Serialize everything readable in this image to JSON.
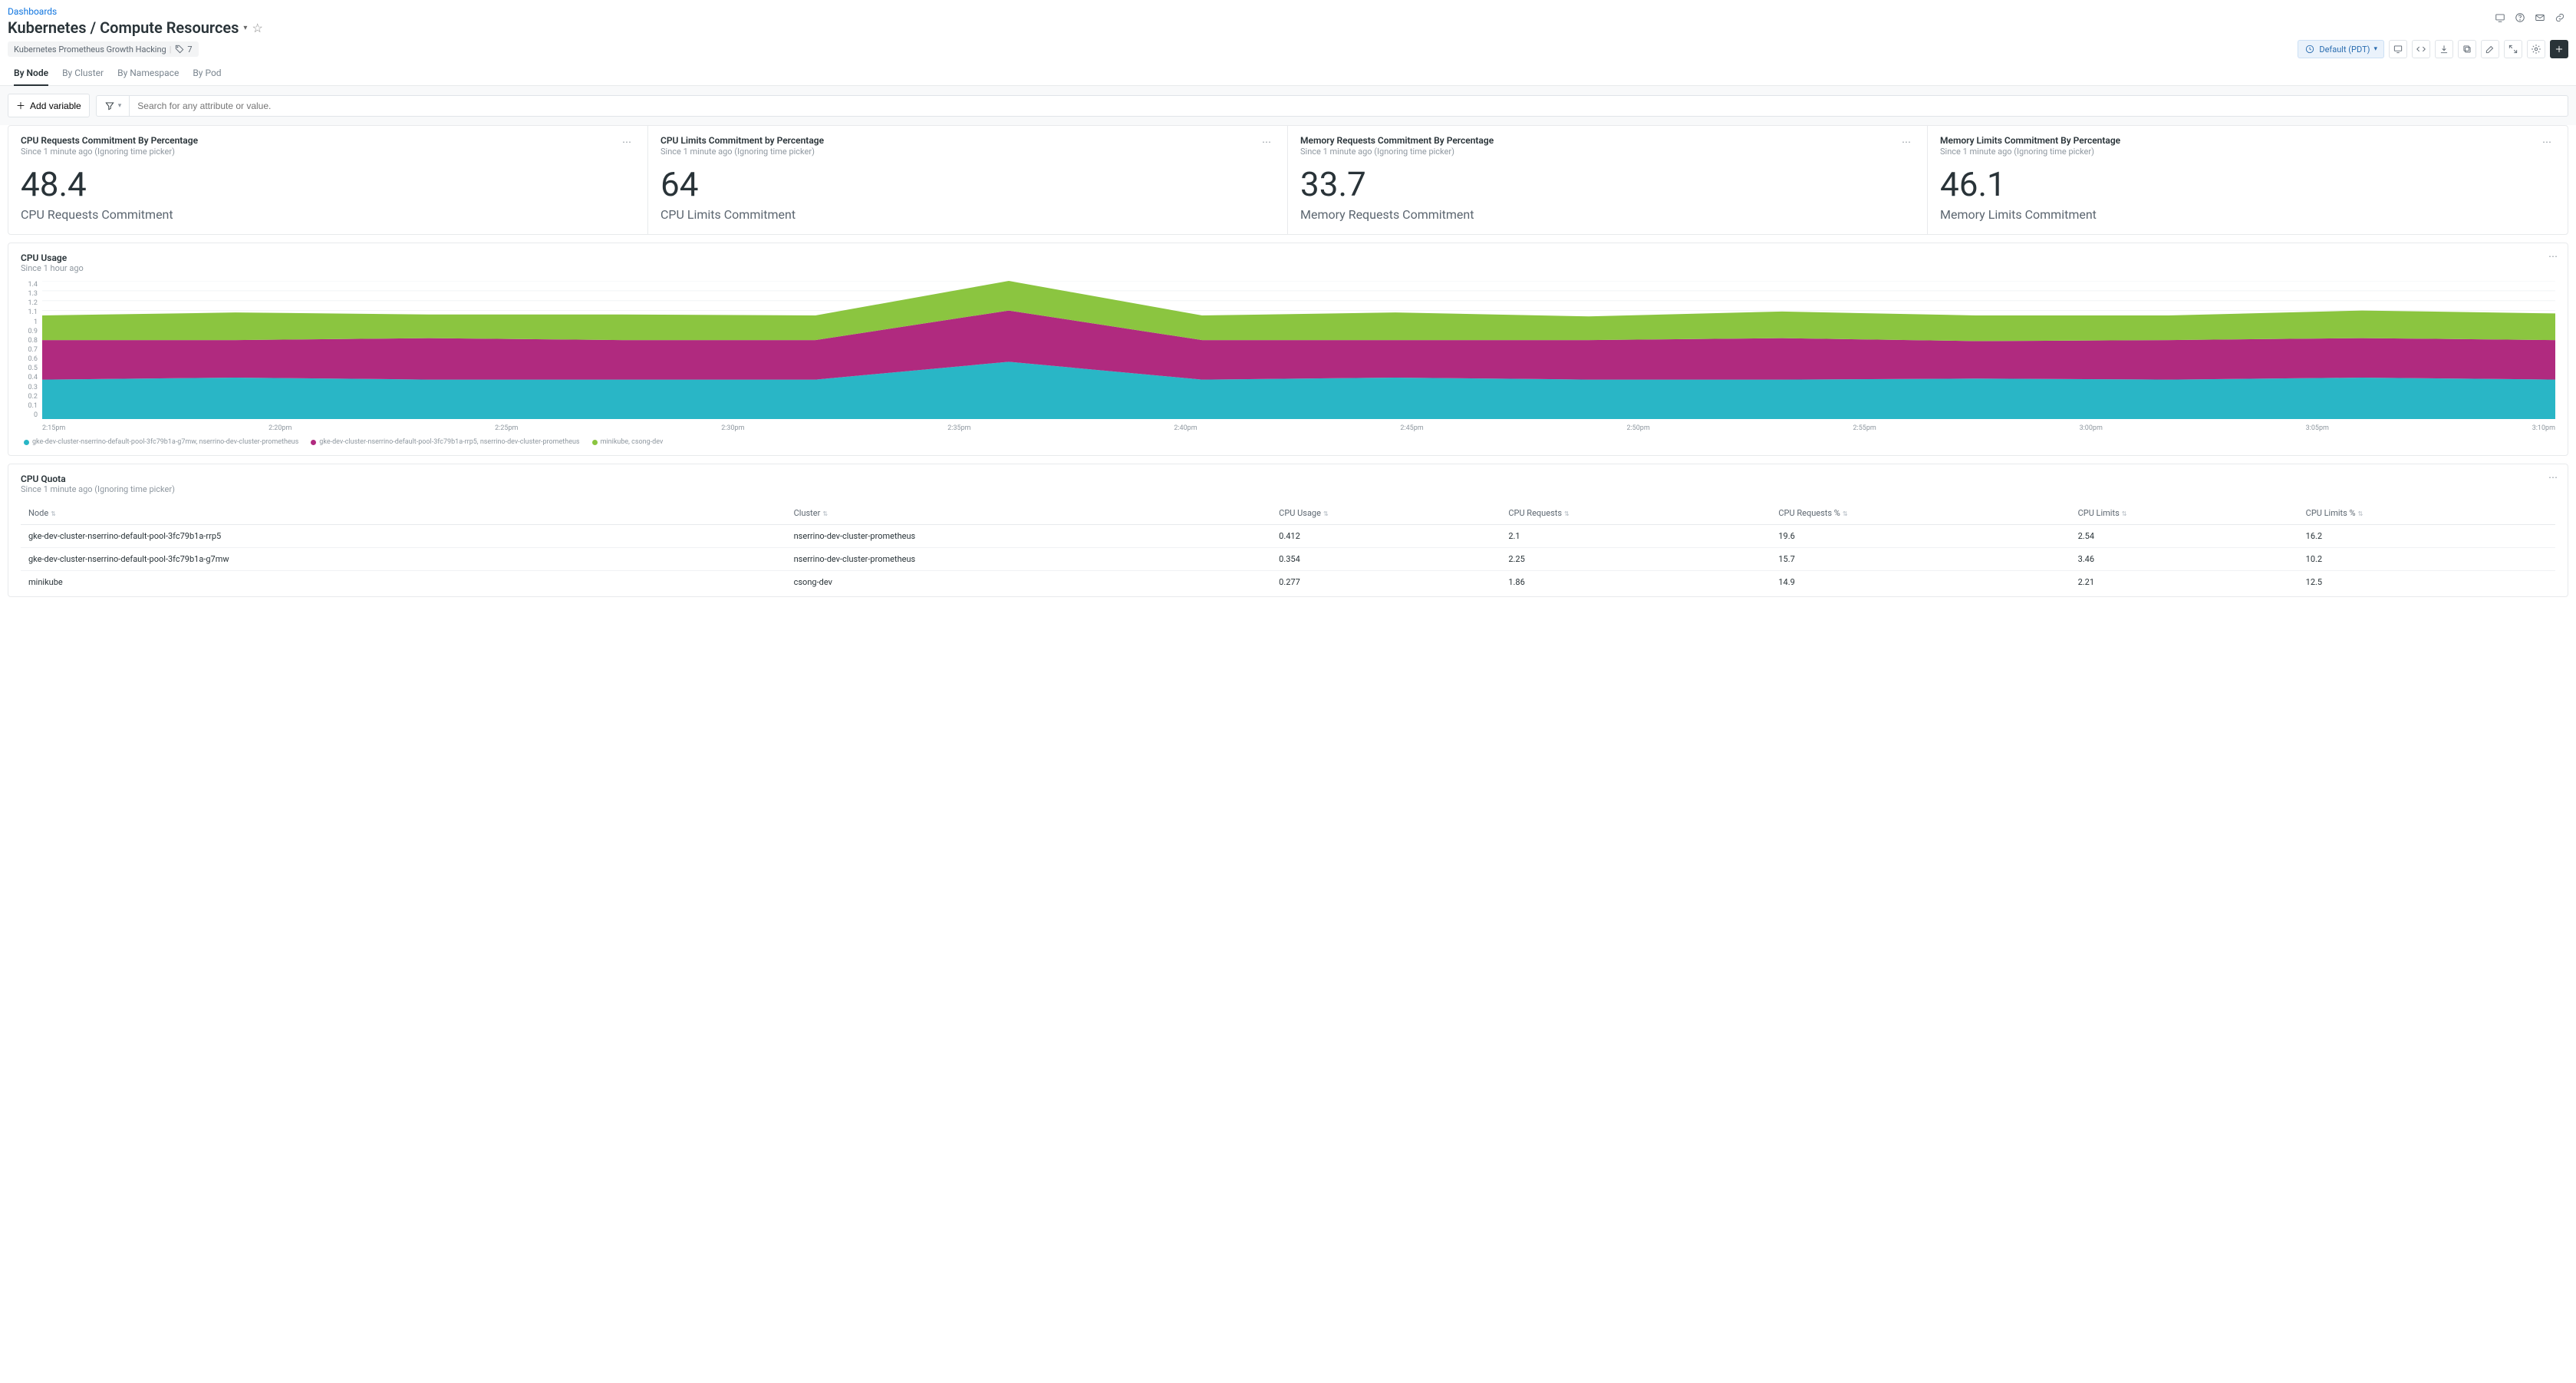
{
  "breadcrumb": "Dashboards",
  "title": "Kubernetes / Compute Resources",
  "project_chip": "Kubernetes Prometheus Growth Hacking",
  "tag_count": "7",
  "time_picker": {
    "label": "Default (PDT)"
  },
  "tabs": [
    "By Node",
    "By Cluster",
    "By Namespace",
    "By Pod"
  ],
  "active_tab": 0,
  "add_variable_label": "Add variable",
  "search_placeholder": "Search for any attribute or value.",
  "kpis": [
    {
      "title": "CPU Requests Commitment By Percentage",
      "sub": "Since 1 minute ago (Ignoring time picker)",
      "value": "48.4",
      "label": "CPU Requests Commitment"
    },
    {
      "title": "CPU Limits Commitment by Percentage",
      "sub": "Since 1 minute ago (Ignoring time picker)",
      "value": "64",
      "label": "CPU Limits Commitment"
    },
    {
      "title": "Memory Requests Commitment By Percentage",
      "sub": "Since 1 minute ago (Ignoring time picker)",
      "value": "33.7",
      "label": "Memory Requests Commitment"
    },
    {
      "title": "Memory Limits Commitment By Percentage",
      "sub": "Since 1 minute ago (Ignoring time picker)",
      "value": "46.1",
      "label": "Memory Limits Commitment"
    }
  ],
  "cpu_usage": {
    "title": "CPU Usage",
    "sub": "Since 1 hour ago",
    "y_ticks": [
      "1.4",
      "1.3",
      "1.2",
      "1.1",
      "1",
      "0.9",
      "0.8",
      "0.7",
      "0.6",
      "0.5",
      "0.4",
      "0.3",
      "0.2",
      "0.1",
      "0"
    ],
    "x_ticks": [
      "2:15pm",
      "2:20pm",
      "2:25pm",
      "2:30pm",
      "2:35pm",
      "2:40pm",
      "2:45pm",
      "2:50pm",
      "2:55pm",
      "3:00pm",
      "3:05pm",
      "3:10pm"
    ],
    "legend": [
      {
        "color": "#29b6c6",
        "label": "gke-dev-cluster-nserrino-default-pool-3fc79b1a-g7mw, nserrino-dev-cluster-prometheus"
      },
      {
        "color": "#b02a7f",
        "label": "gke-dev-cluster-nserrino-default-pool-3fc79b1a-rrp5, nserrino-dev-cluster-prometheus"
      },
      {
        "color": "#8bc540",
        "label": "minikube, csong-dev"
      }
    ]
  },
  "chart_data": {
    "type": "area",
    "title": "CPU Usage",
    "xlabel": "",
    "ylabel": "",
    "ylim": [
      0,
      1.4
    ],
    "x": [
      "2:15pm",
      "2:20pm",
      "2:25pm",
      "2:30pm",
      "2:35pm",
      "2:36pm",
      "2:37pm",
      "2:40pm",
      "2:45pm",
      "2:50pm",
      "2:55pm",
      "3:00pm",
      "3:05pm",
      "3:10pm"
    ],
    "series": [
      {
        "name": "gke-dev-cluster-nserrino-default-pool-3fc79b1a-g7mw, nserrino-dev-cluster-prometheus",
        "color": "#29b6c6",
        "values": [
          0.4,
          0.42,
          0.4,
          0.4,
          0.4,
          0.58,
          0.4,
          0.42,
          0.4,
          0.4,
          0.41,
          0.4,
          0.42,
          0.4
        ]
      },
      {
        "name": "gke-dev-cluster-nserrino-default-pool-3fc79b1a-rrp5, nserrino-dev-cluster-prometheus",
        "color": "#b02a7f",
        "values": [
          0.4,
          0.38,
          0.42,
          0.4,
          0.4,
          0.52,
          0.4,
          0.38,
          0.4,
          0.42,
          0.38,
          0.4,
          0.4,
          0.4
        ]
      },
      {
        "name": "minikube, csong-dev",
        "color": "#8bc540",
        "values": [
          0.25,
          0.28,
          0.24,
          0.26,
          0.25,
          0.3,
          0.25,
          0.28,
          0.24,
          0.27,
          0.26,
          0.25,
          0.28,
          0.27
        ]
      }
    ]
  },
  "cpu_quota": {
    "title": "CPU Quota",
    "sub": "Since 1 minute ago (Ignoring time picker)",
    "columns": [
      "Node",
      "Cluster",
      "CPU Usage",
      "CPU Requests",
      "CPU Requests %",
      "CPU Limits",
      "CPU Limits %"
    ],
    "rows": [
      [
        "gke-dev-cluster-nserrino-default-pool-3fc79b1a-rrp5",
        "nserrino-dev-cluster-prometheus",
        "0.412",
        "2.1",
        "19.6",
        "2.54",
        "16.2"
      ],
      [
        "gke-dev-cluster-nserrino-default-pool-3fc79b1a-g7mw",
        "nserrino-dev-cluster-prometheus",
        "0.354",
        "2.25",
        "15.7",
        "3.46",
        "10.2"
      ],
      [
        "minikube",
        "csong-dev",
        "0.277",
        "1.86",
        "14.9",
        "2.21",
        "12.5"
      ]
    ]
  }
}
